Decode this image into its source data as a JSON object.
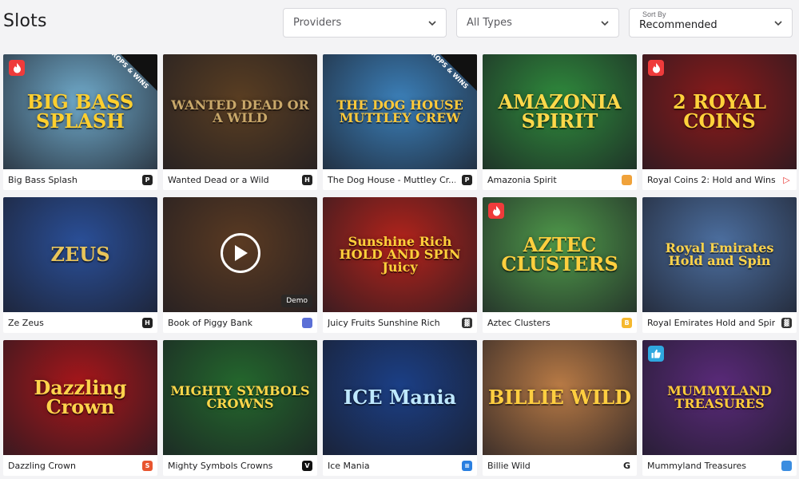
{
  "page": {
    "title": "Slots"
  },
  "filters": {
    "providers": "Providers",
    "types": "All Types",
    "sort_label": "Sort By",
    "sort_value": "Recommended"
  },
  "games": [
    {
      "name": "Big Bass Splash",
      "art": "BIG BASS SPLASH",
      "bg": "#6fa9c9",
      "art_color": "#ffcf2e",
      "badge": "fire",
      "drops": true,
      "provider_icon": "play-provider-icon"
    },
    {
      "name": "Wanted Dead or a Wild",
      "art": "WANTED DEAD OR A WILD",
      "bg": "#5a3e22",
      "art_color": "#c9a86a",
      "badge": "",
      "drops": false,
      "provider_icon": "hacksaw-provider-icon"
    },
    {
      "name": "The Dog House - Muttley Cr...",
      "art": "THE DOG HOUSE MUTTLEY CREW",
      "bg": "#3b7fb8",
      "art_color": "#ffc93a",
      "badge": "",
      "drops": true,
      "provider_icon": "play-provider-icon"
    },
    {
      "name": "Amazonia Spirit",
      "art": "AMAZONIA SPIRIT",
      "bg": "#2f8b3c",
      "art_color": "#ffd84a",
      "badge": "",
      "drops": false,
      "provider_icon": "orange-provider-icon"
    },
    {
      "name": "Royal Coins 2: Hold and Wins",
      "art": "2 ROYAL COINS",
      "bg": "#8b1a1a",
      "art_color": "#ffd23b",
      "badge": "fire",
      "drops": false,
      "provider_icon": "red-arrow-provider-icon"
    },
    {
      "name": "Ze Zeus",
      "art": "ZEUS",
      "bg": "#2a4f98",
      "art_color": "#e8c45a",
      "badge": "",
      "drops": false,
      "provider_icon": "hacksaw-provider-icon"
    },
    {
      "name": "Book of Piggy Bank",
      "art": "",
      "bg": "#5a3a22",
      "art_color": "#d4a04a",
      "badge": "",
      "drops": false,
      "provider_icon": "blue-provider-icon",
      "play": true,
      "demo": "Demo"
    },
    {
      "name": "Juicy Fruits Sunshine Rich",
      "art": "Sunshine Rich HOLD AND SPIN Juicy",
      "bg": "#b3231b",
      "art_color": "#ffd03a",
      "badge": "",
      "drops": false,
      "provider_icon": "grid-provider-icon"
    },
    {
      "name": "Aztec Clusters",
      "art": "AZTEC CLUSTERS",
      "bg": "#4f9a4a",
      "art_color": "#ffcf3e",
      "badge": "fire",
      "drops": false,
      "provider_icon": "b-provider-icon"
    },
    {
      "name": "Royal Emirates Hold and Spin",
      "art": "Royal Emirates Hold and Spin",
      "bg": "#4c6fa0",
      "art_color": "#ffd34a",
      "badge": "",
      "drops": false,
      "provider_icon": "grid-provider-icon"
    },
    {
      "name": "Dazzling Crown",
      "art": "Dazzling Crown",
      "bg": "#a8161a",
      "art_color": "#ffd44c",
      "badge": "",
      "drops": false,
      "provider_icon": "s-provider-icon"
    },
    {
      "name": "Mighty Symbols Crowns",
      "art": "MIGHTY SYMBOLS CROWNS",
      "bg": "#24682d",
      "art_color": "#ffd74a",
      "badge": "",
      "drops": false,
      "provider_icon": "v-provider-icon"
    },
    {
      "name": "Ice Mania",
      "art": "ICE Mania",
      "bg": "#1b3f86",
      "art_color": "#bfe9ff",
      "badge": "",
      "drops": false,
      "provider_icon": "stripes-provider-icon"
    },
    {
      "name": "Billie Wild",
      "art": "BILLIE WILD",
      "bg": "#b87a45",
      "art_color": "#ffce40",
      "badge": "",
      "drops": false,
      "provider_icon": "g-provider-icon"
    },
    {
      "name": "Mummyland Treasures",
      "art": "MUMMYLAND TREASURES",
      "bg": "#5a2a7a",
      "art_color": "#ffcb3a",
      "badge": "like",
      "drops": false,
      "provider_icon": "globe-provider-icon"
    }
  ],
  "drops_label": "DROPS & WINS"
}
